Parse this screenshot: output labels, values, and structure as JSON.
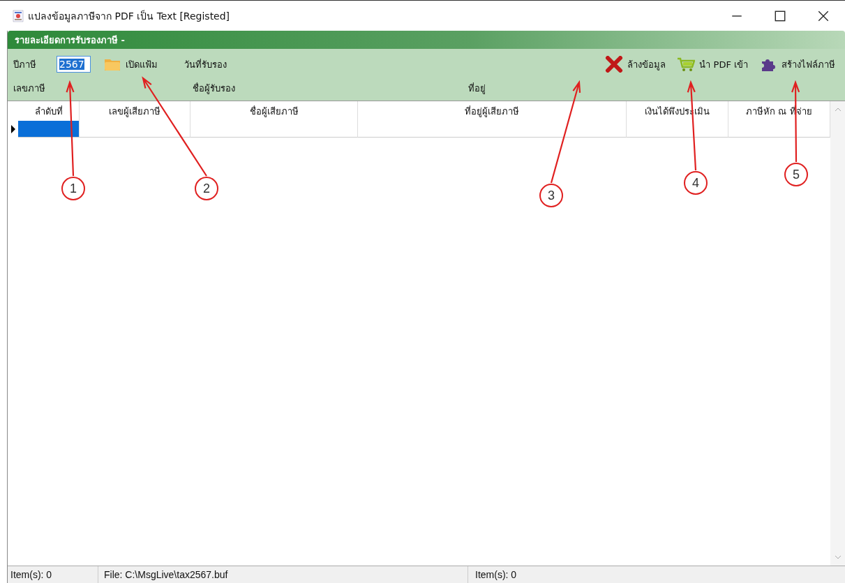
{
  "window": {
    "title": "แปลงข้อมูลภาษีจาก PDF เป็น Text [Registed]"
  },
  "panel": {
    "title": "รายละเอียดการรับรองภาษี -"
  },
  "toolbar": {
    "year_label": "ปีภาษี",
    "year_field": {
      "value": "2567",
      "text_selected": true
    },
    "open_button": "เปิดแฟ้ม",
    "date_label": "วันที่รับรอง",
    "tax_id_label": "เลขภาษี",
    "certifier_label": "ชื่อผู้รับรอง",
    "address_label": "ที่อยู่",
    "actions": [
      {
        "kind": "clear",
        "label": "ล้างข้อมูล"
      },
      {
        "kind": "import",
        "label": "นำ PDF เข้า"
      },
      {
        "kind": "build",
        "label": "สร้างไฟล์ภาษี"
      }
    ]
  },
  "table": {
    "columns": [
      "ลำดับที่",
      "เลขผู้เสียภาษี",
      "ชื่อผู้เสียภาษี",
      "ที่อยู่ผู้เสียภาษี",
      "เงินได้พึงประเมิน",
      "ภาษีหัก ณ ที่จ่าย"
    ],
    "rows": [
      {
        "current": true
      }
    ]
  },
  "status_bar": [
    "Item(s): 0",
    "File: C:\\MsgLive\\tax2567.buf",
    "Item(s): 0"
  ],
  "callouts": [
    "1",
    "2",
    "3",
    "4",
    "5"
  ]
}
